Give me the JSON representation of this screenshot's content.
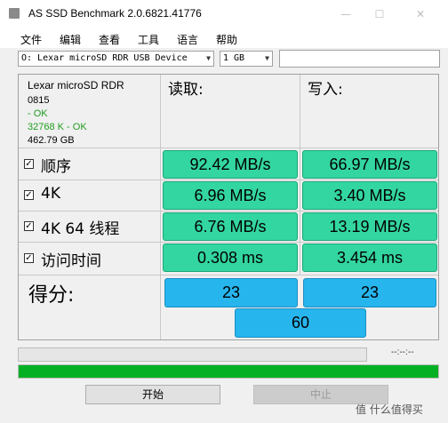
{
  "window": {
    "title": "AS SSD Benchmark 2.0.6821.41776",
    "min": "—",
    "max": "☐",
    "close": "✕"
  },
  "menu": [
    "文件",
    "编辑",
    "查看",
    "工具",
    "语言",
    "帮助"
  ],
  "device_select": {
    "value": "O: Lexar microSD RDR USB Device"
  },
  "size_select": {
    "value": "1 GB"
  },
  "drive_info": {
    "name": "Lexar microSD RDR",
    "firmware": "0815",
    "driver_status": " - OK",
    "alignment": "32768 K - OK",
    "capacity": "462.79 GB"
  },
  "headers": {
    "read": "读取:",
    "write": "写入:"
  },
  "rows": [
    {
      "label": "顺序",
      "read": "92.42 MB/s",
      "write": "66.97 MB/s"
    },
    {
      "label": "4K",
      "read": "6.96 MB/s",
      "write": "3.40 MB/s"
    },
    {
      "label": "4K 64 线程",
      "read": "6.76 MB/s",
      "write": "13.19 MB/s"
    },
    {
      "label": "访问时间",
      "read": "0.308 ms",
      "write": "3.454 ms"
    }
  ],
  "score": {
    "label": "得分:",
    "read": "23",
    "write": "23",
    "total": "60"
  },
  "progress": {
    "time": "--:--:--",
    "fraction": 1.0,
    "color": "#06b025"
  },
  "buttons": {
    "start": "开始",
    "stop": "中止"
  },
  "watermark": "值 什么值得买",
  "colors": {
    "result_bg": "#33d6a0",
    "score_bg": "#27b5ee",
    "status_ok": "#1f9e1f"
  }
}
